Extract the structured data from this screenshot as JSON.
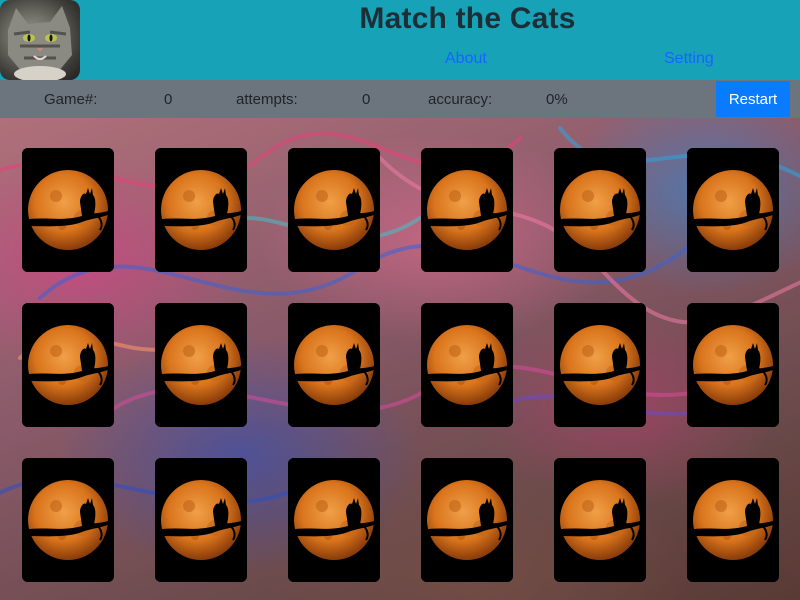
{
  "app": {
    "title": "Match the Cats",
    "nav": [
      {
        "label": "About"
      },
      {
        "label": "Setting"
      }
    ]
  },
  "stats": {
    "game_label": "Game#:",
    "game_value": "0",
    "attempts_label": "attempts:",
    "attempts_value": "0",
    "accuracy_label": "accuracy:",
    "accuracy_value": "0%",
    "restart_label": "Restart"
  },
  "board": {
    "rows": 3,
    "cols": 6,
    "card_back": "moon-cat-silhouette",
    "cards_face_down": 18
  },
  "colors": {
    "header": "#17a2b8",
    "stats_bar": "#6c757d",
    "restart_button": "#0a7bff",
    "nav_link": "#1565ff",
    "title": "#1c2e36"
  }
}
